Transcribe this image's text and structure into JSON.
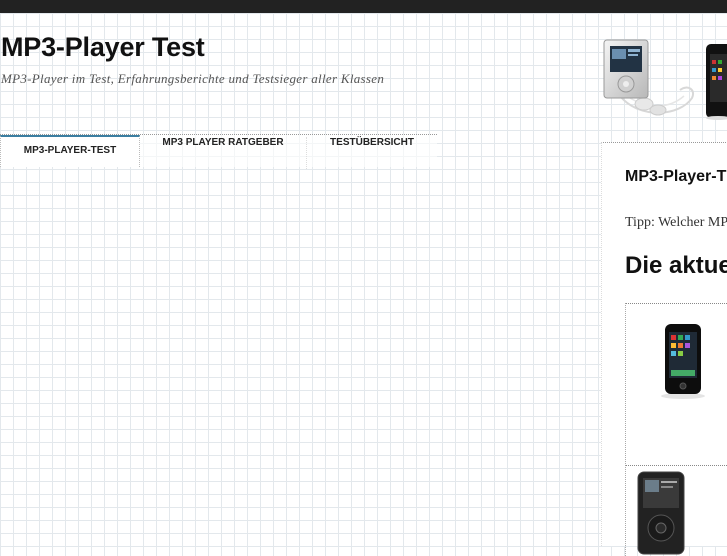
{
  "site": {
    "title": "MP3-Player Test",
    "tagline": "MP3-Player im Test, Erfahrungsberichte und Testsieger aller Klassen"
  },
  "nav": {
    "items": [
      {
        "label": "MP3-PLAYER-TEST",
        "active": true
      },
      {
        "label": "MP3 PLAYER RATGEBER",
        "active": false
      },
      {
        "label": "TESTÜBERSICHT",
        "active": false
      }
    ],
    "accent_color": "#3b7ea1"
  },
  "sidebar": {
    "title": "MP3-Player-T",
    "tip": "Tipp: Welcher MP",
    "heading": "Die aktue"
  }
}
